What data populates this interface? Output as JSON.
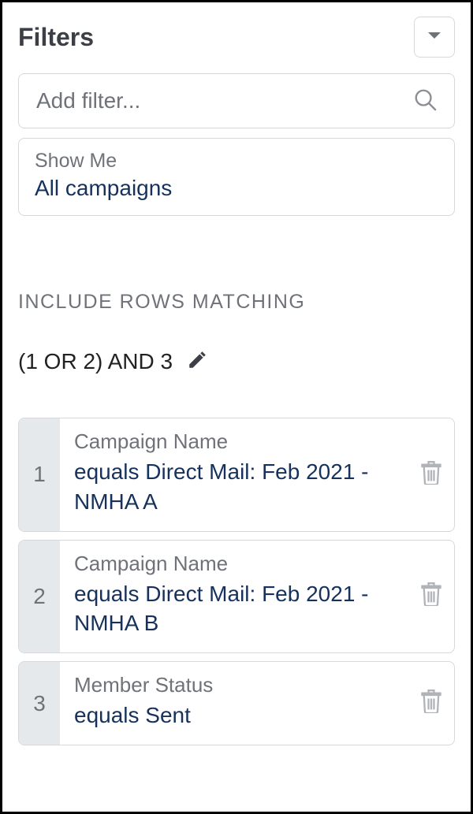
{
  "header": {
    "title": "Filters"
  },
  "search": {
    "placeholder": "Add filter..."
  },
  "showMe": {
    "label": "Show Me",
    "value": "All campaigns"
  },
  "matchSection": {
    "heading": "Include Rows Matching",
    "logicExpression": "(1 OR 2) AND 3"
  },
  "filters": [
    {
      "index": "1",
      "field": "Campaign Name",
      "condition": "equals Direct Mail: Feb 2021 - NMHA A"
    },
    {
      "index": "2",
      "field": "Campaign Name",
      "condition": "equals Direct Mail: Feb 2021 - NMHA B"
    },
    {
      "index": "3",
      "field": "Member Status",
      "condition": "equals Sent"
    }
  ]
}
